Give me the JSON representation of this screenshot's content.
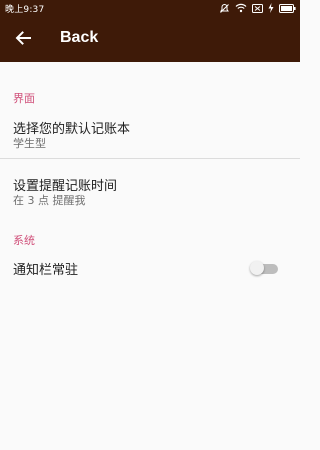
{
  "status_bar": {
    "time": "晚上9:37",
    "icons": [
      "mute-icon",
      "wifi-icon",
      "sim-icon",
      "charging-icon",
      "battery-icon"
    ]
  },
  "toolbar": {
    "title": "Back",
    "icon": "back-arrow-icon"
  },
  "sections": {
    "interface": {
      "header": "界面"
    },
    "system": {
      "header": "系统"
    }
  },
  "preferences": {
    "default_account_book": {
      "title": "选择您的默认记账本",
      "summary": "学生型"
    },
    "reminder_time": {
      "title": "设置提醒记账时间",
      "summary": "在 3 点 提醒我"
    },
    "notification_bar": {
      "title": "通知栏常驻",
      "switch_on": false
    }
  },
  "colors": {
    "app_bar": "#3e1a08",
    "accent": "#d0507a",
    "background": "#fafafa"
  }
}
